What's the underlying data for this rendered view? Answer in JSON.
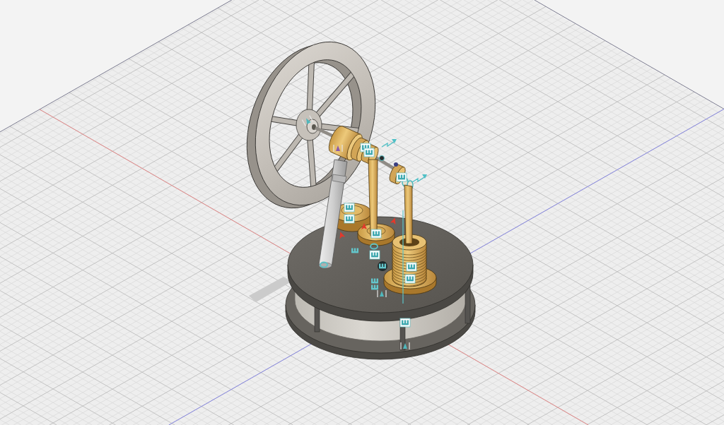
{
  "viewport": {
    "grid_visible": true,
    "axis_lines_visible": true
  }
}
